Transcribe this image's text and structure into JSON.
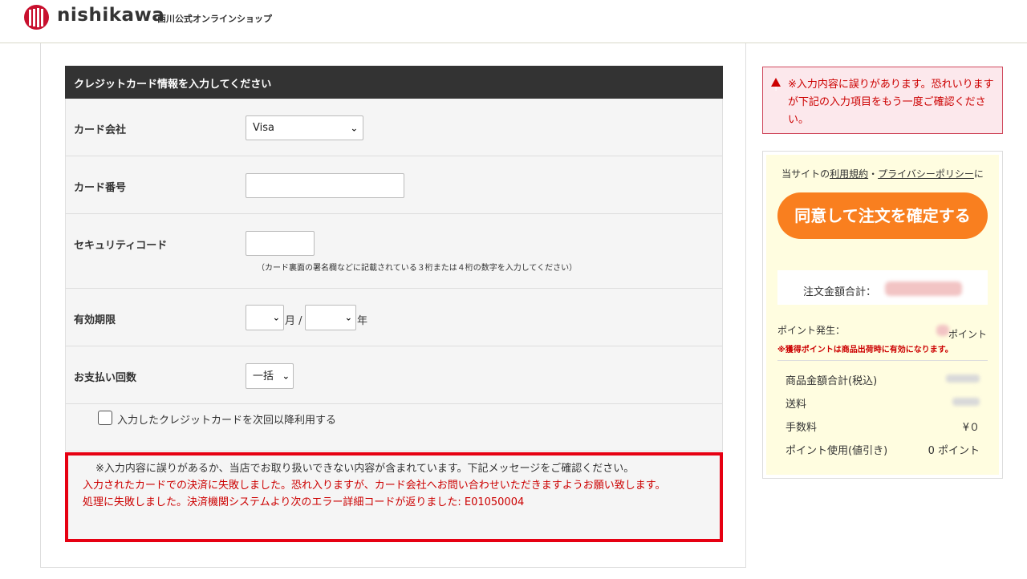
{
  "header": {
    "logo_text": "nishikawa",
    "subtitle": "西川公式オンラインショップ"
  },
  "form": {
    "title": "クレジットカード情報を入力してください",
    "card_company": {
      "label": "カード会社",
      "selected": "Visa"
    },
    "card_number": {
      "label": "カード番号",
      "value": ""
    },
    "security_code": {
      "label": "セキュリティコード",
      "value": "",
      "hint": "（カード裏面の署名欄などに記載されている３桁または４桁の数字を入力してください）"
    },
    "expiry": {
      "label": "有効期限",
      "month": "",
      "month_unit": "月 /",
      "year": "",
      "year_unit": "年"
    },
    "installments": {
      "label": "お支払い回数",
      "selected": "一括"
    },
    "save_card": {
      "label": "入力したクレジットカードを次回以降利用する",
      "checked": false
    }
  },
  "error": {
    "line1": "※入力内容に誤りがあるか、当店でお取り扱いできない内容が含まれています。下記メッセージをご確認ください。",
    "line2": "入力されたカードでの決済に失敗しました。恐れ入りますが、カード会社へお問い合わせいただきますようお願い致します。",
    "line3": "処理に失敗しました。決済機関システムより次のエラー詳細コードが返りました: E01050004"
  },
  "sidebar": {
    "alert": "※入力内容に誤りがあります。恐れいりますが下記の入力項目をもう一度ご確認ください。",
    "terms_prefix": "当サイトの",
    "terms_link": "利用規約",
    "terms_sep": "・",
    "privacy_link": "プライバシーポリシー",
    "terms_suffix": "に",
    "confirm_button": "同意して注文を確定する",
    "total_label": "注文金額合計：",
    "points_label": "ポイント発生：",
    "points_unit": "ポイント",
    "points_note": "※獲得ポイントは商品出荷時に有効になります。",
    "summary": [
      {
        "label": "商品金額合計(税込)",
        "value": ""
      },
      {
        "label": "送料",
        "value": ""
      },
      {
        "label": "手数料",
        "value": "¥０"
      },
      {
        "label": "ポイント使用(値引き)",
        "value": "0 ポイント"
      }
    ]
  },
  "colors": {
    "accent_orange": "#f97f1f",
    "error_red": "#e60012",
    "brand_red": "#c8102e"
  }
}
